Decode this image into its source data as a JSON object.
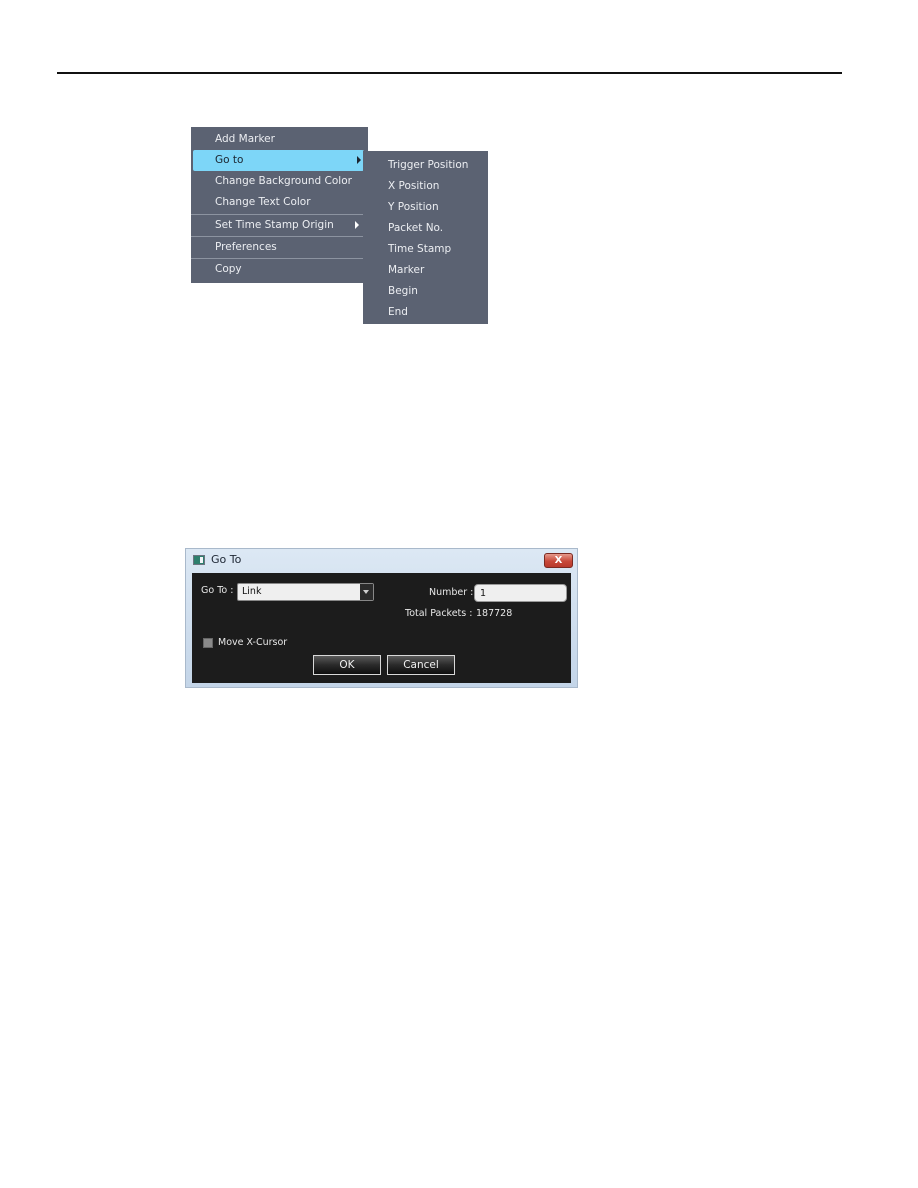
{
  "context_menu": {
    "items": [
      {
        "label": "Add Marker",
        "has_submenu": false,
        "active": false
      },
      {
        "label": "Go to",
        "has_submenu": true,
        "active": true
      },
      {
        "label": "Change Background Color",
        "has_submenu": false,
        "active": false
      },
      {
        "label": "Change Text Color",
        "has_submenu": false,
        "active": false
      },
      {
        "label": "Set Time Stamp Origin",
        "has_submenu": true,
        "active": false
      },
      {
        "label": "Preferences",
        "has_submenu": false,
        "active": false
      },
      {
        "label": "Copy",
        "has_submenu": false,
        "active": false
      }
    ],
    "colors": {
      "background": "#5b6272",
      "highlight": "#7dd6f8",
      "text": "#eceef2"
    }
  },
  "submenu": {
    "parent": "Go to",
    "items": [
      {
        "label": "Trigger Position"
      },
      {
        "label": "X Position"
      },
      {
        "label": "Y Position"
      },
      {
        "label": "Packet No."
      },
      {
        "label": "Time Stamp"
      },
      {
        "label": "Marker"
      },
      {
        "label": "Begin"
      },
      {
        "label": "End"
      }
    ]
  },
  "dialog": {
    "title": "Go To",
    "icon": "window-app-icon",
    "close_label": "X",
    "goto_label": "Go To :",
    "goto_value": "Link",
    "number_label": "Number :",
    "number_value": "1",
    "total_packets_label": "Total Packets :",
    "total_packets_value": "187728",
    "move_cursor_label": "Move X-Cursor",
    "move_cursor_checked": false,
    "ok_label": "OK",
    "cancel_label": "Cancel"
  }
}
